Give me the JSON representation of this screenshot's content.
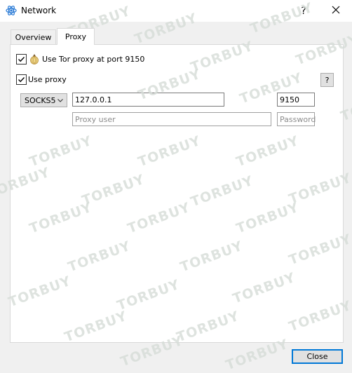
{
  "window": {
    "title": "Network"
  },
  "titlebar": {
    "help_glyph": "?",
    "close_glyph": "✕"
  },
  "tabs": [
    {
      "label": "Overview",
      "selected": false
    },
    {
      "label": "Proxy",
      "selected": true
    }
  ],
  "proxy": {
    "tor_checkbox": {
      "label": "Use Tor proxy at port 9150",
      "checked": true
    },
    "use_proxy_checkbox": {
      "label": "Use proxy",
      "checked": true
    },
    "help_button": "?",
    "type_select": {
      "value": "SOCKS5"
    },
    "host_field": {
      "value": "127.0.0.1"
    },
    "port_field": {
      "value": "9150"
    },
    "user_field": {
      "placeholder": "Proxy user"
    },
    "password_field": {
      "placeholder": "Password"
    }
  },
  "footer": {
    "close_label": "Close"
  },
  "watermark": {
    "text": "TORBUY"
  },
  "colors": {
    "accent": "#0078d7",
    "watermark": "#d6ddd8"
  }
}
